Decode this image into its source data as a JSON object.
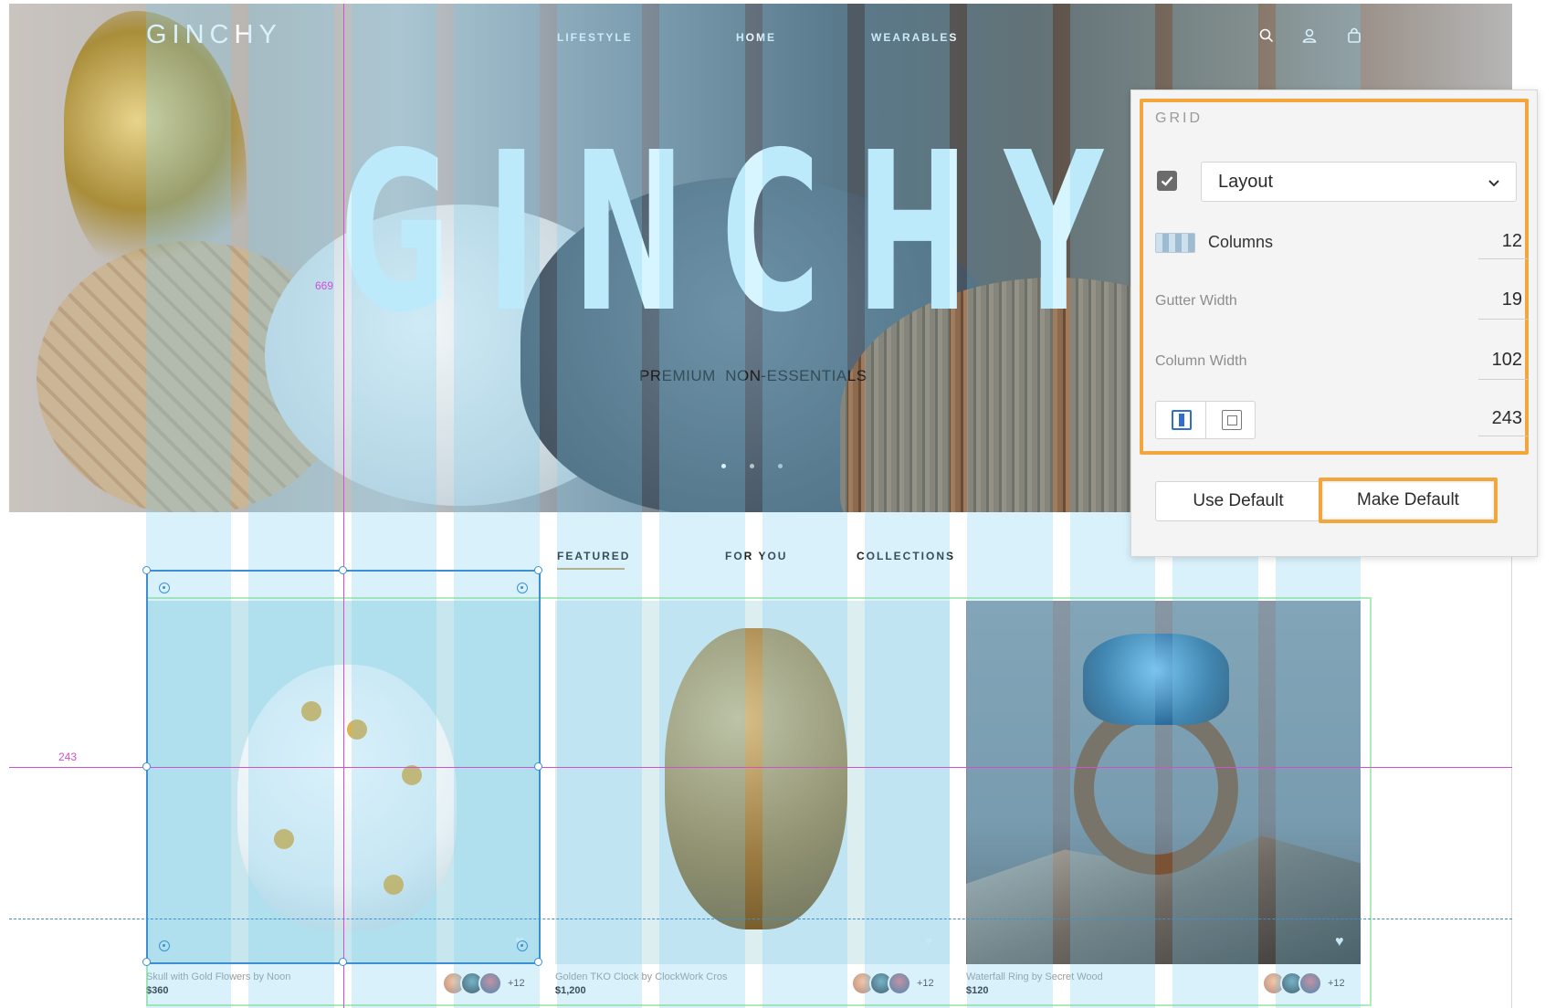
{
  "site": {
    "logo": "GINCHY",
    "nav": [
      "LIFESTYLE",
      "HOME",
      "WEARABLES"
    ],
    "icons": [
      "search-icon",
      "account-icon",
      "bag-icon"
    ]
  },
  "hero": {
    "title": "GINCHY",
    "subtitle": "PREMIUM  NON-ESSENTIALS",
    "carousel": {
      "count": 3,
      "active_index": 0
    }
  },
  "tabs": [
    {
      "label": "FEATURED",
      "active": true
    },
    {
      "label": "FOR YOU",
      "active": false
    },
    {
      "label": "COLLECTIONS",
      "active": false
    }
  ],
  "products": [
    {
      "name": "Skull with Gold Flowers by Noon",
      "price": "$360",
      "extra_count": "+12"
    },
    {
      "name": "Golden TKO Clock by ClockWork Cros",
      "price": "$1,200",
      "extra_count": "+12"
    },
    {
      "name": "Waterfall Ring by Secret Wood",
      "price": "$120",
      "extra_count": "+12"
    }
  ],
  "guides": {
    "vertical_label": "669",
    "horizontal_label": "243"
  },
  "grid_panel": {
    "title": "GRID",
    "enabled": true,
    "type_selected": "Layout",
    "columns_label": "Columns",
    "columns_value": "12",
    "gutter_label": "Gutter Width",
    "gutter_value": "19",
    "column_width_label": "Column Width",
    "column_width_value": "102",
    "layout_size_value": "243",
    "use_default_label": "Use Default",
    "make_default_label": "Make Default"
  },
  "colors": {
    "highlight": "#f3a63c",
    "guide": "#d24fd2",
    "selection": "#3d8fd1",
    "grid_column": "#78cdf0"
  }
}
